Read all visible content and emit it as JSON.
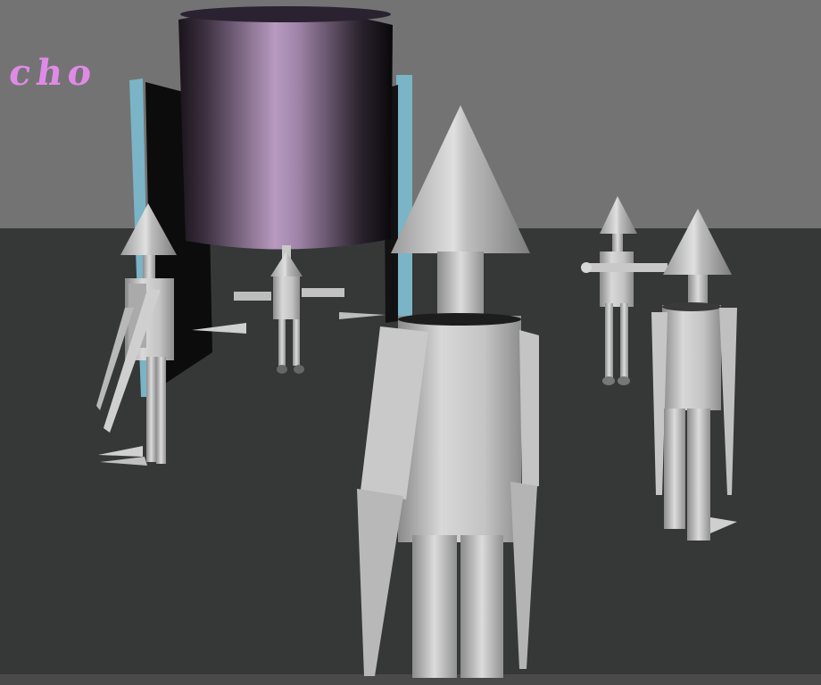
{
  "scene": {
    "billboard_text": "cho",
    "colors": {
      "sky": "#737373",
      "ground": "#353837",
      "banner_pink": "#e08ae8",
      "pillar_blue": "#7ab4c6",
      "figure_light": "#d2d2d2",
      "figure_mid": "#a8a8a8",
      "figure_dark": "#7a7a7a"
    },
    "objects": [
      "cylinder-tower",
      "blue-pillar-left",
      "blue-pillar-right",
      "robot-figure-front",
      "robot-figure-left",
      "robot-figure-center-back",
      "robot-figure-right-back",
      "robot-figure-right"
    ]
  }
}
